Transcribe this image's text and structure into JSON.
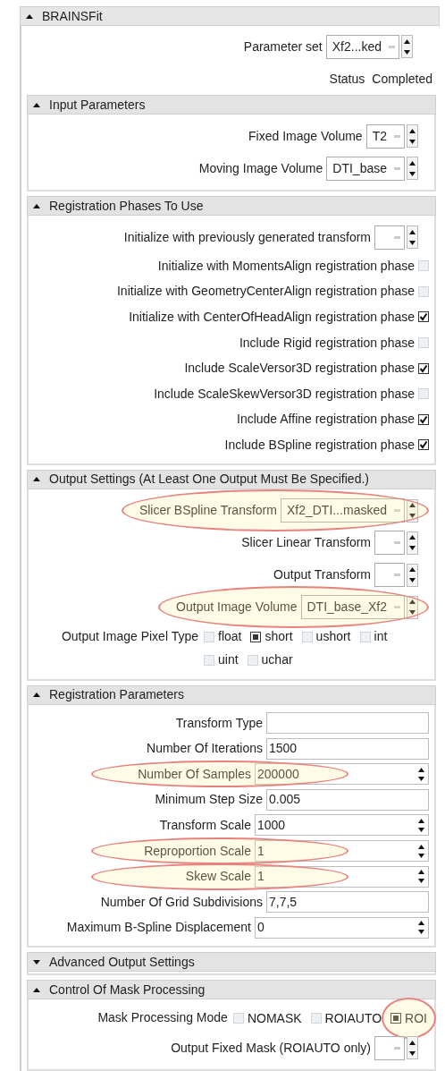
{
  "panel": {
    "title": "BRAINSFit",
    "expanded": true
  },
  "parameter_set": {
    "label": "Parameter set",
    "value": "Xf2...ked"
  },
  "status": {
    "label": "Status",
    "value": "Completed"
  },
  "sections": [
    {
      "title": "Input Parameters",
      "expanded": true,
      "rows": [
        {
          "kind": "combo",
          "label": "Fixed Image Volume",
          "value": "T2"
        },
        {
          "kind": "combo",
          "label": "Moving Image Volume",
          "value": "DTI_base"
        }
      ]
    },
    {
      "title": "Registration Phases To Use",
      "expanded": true,
      "rows": [
        {
          "kind": "combo",
          "label": "Initialize with previously generated transform"
        },
        {
          "kind": "checkbox",
          "label": "Initialize with MomentsAlign registration phase",
          "checked": false
        },
        {
          "kind": "checkbox",
          "label": "Initialize with GeometryCenterAlign registration phase",
          "checked": false
        },
        {
          "kind": "checkbox",
          "label": "Initialize with CenterOfHeadAlign registration phase",
          "checked": true
        },
        {
          "kind": "checkbox",
          "label": "Include Rigid registration phase",
          "checked": false
        },
        {
          "kind": "checkbox",
          "label": "Include ScaleVersor3D registration phase",
          "checked": true
        },
        {
          "kind": "checkbox",
          "label": "Include ScaleSkewVersor3D registration phase",
          "checked": false
        },
        {
          "kind": "checkbox",
          "label": "Include Affine registration phase",
          "checked": true
        },
        {
          "kind": "checkbox",
          "label": "Include BSpline registration phase",
          "checked": true
        }
      ]
    },
    {
      "title": "Output Settings (At Least One Output Must Be Specified.)",
      "expanded": true,
      "rows": [
        {
          "kind": "combo",
          "label": "Slicer BSpline Transform",
          "value": "Xf2_DTI...masked",
          "highlighted": true
        },
        {
          "kind": "combo",
          "label": "Slicer Linear Transform"
        },
        {
          "kind": "combo",
          "label": "Output Transform"
        },
        {
          "kind": "combo",
          "label": "Output Image Volume",
          "value": "DTI_base_Xf2",
          "highlighted": true
        },
        {
          "kind": "radio",
          "label": "Output Image Pixel Type",
          "options": [
            {
              "label": "float",
              "selected": false
            },
            {
              "label": "short",
              "selected": true
            },
            {
              "label": "ushort",
              "selected": false
            },
            {
              "label": "int",
              "selected": false
            },
            {
              "label": "uint",
              "selected": false
            },
            {
              "label": "uchar",
              "selected": false
            }
          ]
        }
      ]
    },
    {
      "title": "Registration Parameters",
      "expanded": true,
      "rows": [
        {
          "kind": "text",
          "label": "Transform Type"
        },
        {
          "kind": "text",
          "label": "Number Of Iterations",
          "value": "1500"
        },
        {
          "kind": "spin",
          "label": "Number Of Samples",
          "value": "200000",
          "highlighted": true
        },
        {
          "kind": "text",
          "label": "Minimum Step Size",
          "value": "0.005"
        },
        {
          "kind": "spin",
          "label": "Transform Scale",
          "value": "1000"
        },
        {
          "kind": "spin",
          "label": "Reproportion Scale",
          "value": "1",
          "highlighted": true
        },
        {
          "kind": "spin",
          "label": "Skew Scale",
          "value": "1",
          "highlighted": true
        },
        {
          "kind": "text",
          "label": "Number Of Grid Subdivisions",
          "value": "7,7,5"
        },
        {
          "kind": "spin",
          "label": "Maximum B-Spline Displacement",
          "value": "0"
        }
      ]
    },
    {
      "title": "Advanced Output Settings",
      "expanded": false
    },
    {
      "title": "Control Of Mask Processing",
      "expanded": true,
      "rows": [
        {
          "kind": "radio",
          "label": "Mask Processing Mode",
          "options": [
            {
              "label": "NOMASK",
              "selected": false
            },
            {
              "label": "ROIAUTO",
              "selected": false
            },
            {
              "label": "ROI",
              "selected": true,
              "highlighted": true
            }
          ]
        },
        {
          "kind": "combo",
          "label": "Output Fixed Mask (ROIAUTO only)"
        }
      ]
    }
  ]
}
